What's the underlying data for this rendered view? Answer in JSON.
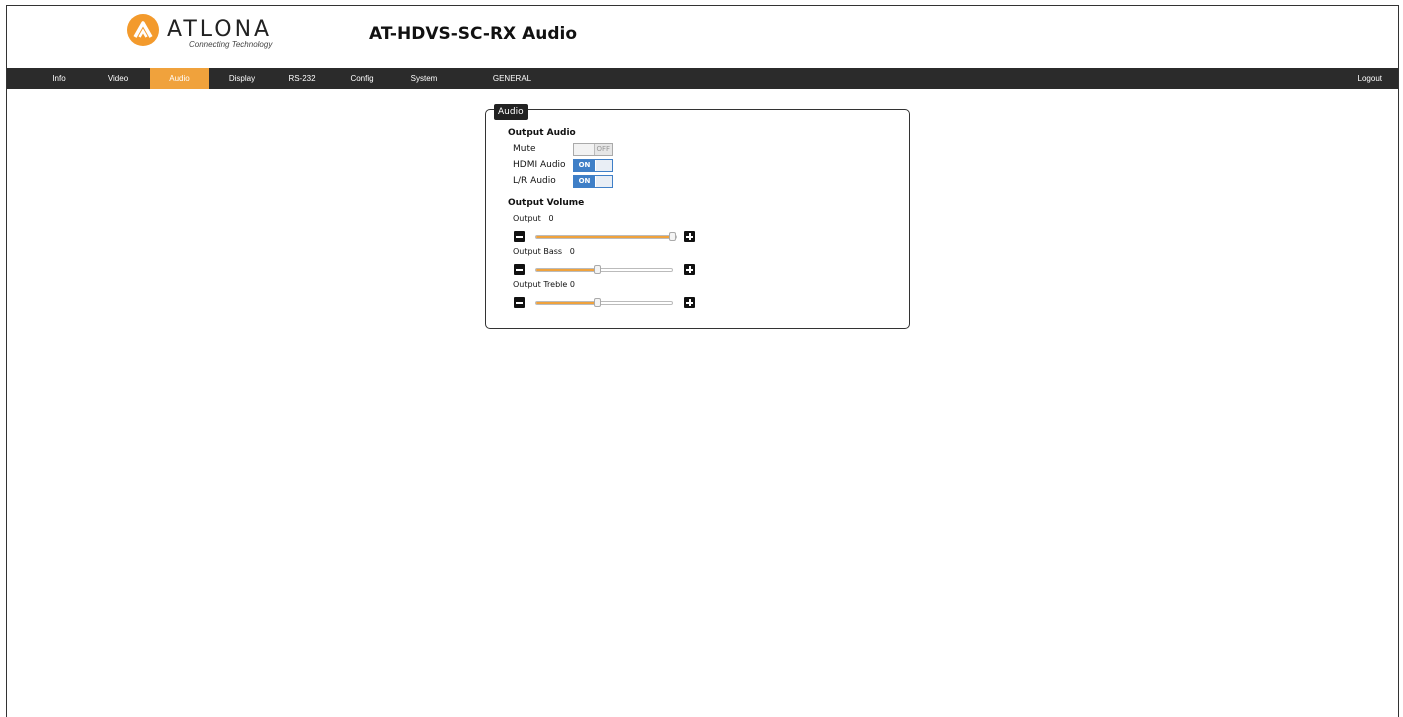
{
  "brand": {
    "logo_text": "ATLONA",
    "tagline": "Connecting Technology",
    "accent_color": "#f0a23c"
  },
  "header": {
    "title": "AT-HDVS-SC-RX  Audio"
  },
  "nav": {
    "items": [
      {
        "label": "Info",
        "active": false
      },
      {
        "label": "Video",
        "active": false
      },
      {
        "label": "Audio",
        "active": true
      },
      {
        "label": "Display",
        "active": false
      },
      {
        "label": "RS-232",
        "active": false
      },
      {
        "label": "Config",
        "active": false
      },
      {
        "label": "System",
        "active": false
      },
      {
        "label": "GENERAL",
        "active": false
      }
    ],
    "logout": "Logout"
  },
  "panel": {
    "tab_label": "Audio",
    "output_audio": {
      "heading": "Output Audio",
      "mute": {
        "label": "Mute",
        "state": "OFF"
      },
      "hdmi_audio": {
        "label": "HDMI Audio",
        "state": "ON"
      },
      "lr_audio": {
        "label": "L/R Audio",
        "state": "ON"
      }
    },
    "output_volume": {
      "heading": "Output Volume",
      "output": {
        "label": "Output",
        "value": "0",
        "level": 1.0
      },
      "bass": {
        "label": "Output Bass",
        "value": "0",
        "level": 0.45
      },
      "treble": {
        "label": "Output Treble",
        "value": "0",
        "level": 0.45
      }
    }
  }
}
